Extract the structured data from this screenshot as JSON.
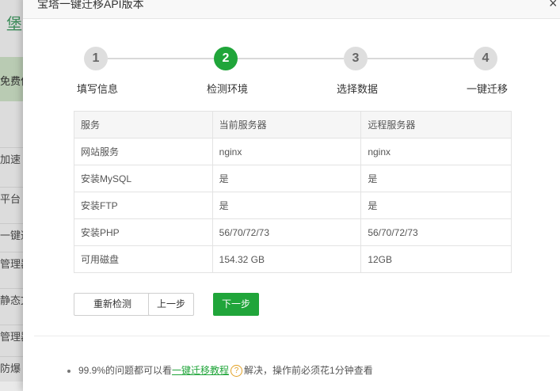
{
  "background": {
    "brand": "堡",
    "free_label": "免费使",
    "menu_items": [
      "加速",
      "平台",
      "一键迁",
      "管理器",
      "静态文",
      "管理器",
      "防爆"
    ]
  },
  "dialog": {
    "title": "宝塔一键迁移API版本",
    "close_symbol": "×",
    "steps": [
      {
        "number": "1",
        "label": "填写信息",
        "active": false
      },
      {
        "number": "2",
        "label": "检测环境",
        "active": true
      },
      {
        "number": "3",
        "label": "选择数据",
        "active": false
      },
      {
        "number": "4",
        "label": "一键迁移",
        "active": false
      }
    ],
    "table": {
      "headers": [
        "服务",
        "当前服务器",
        "远程服务器"
      ],
      "rows": [
        [
          "网站服务",
          "nginx",
          "nginx"
        ],
        [
          "安装MySQL",
          "是",
          "是"
        ],
        [
          "安装FTP",
          "是",
          "是"
        ],
        [
          "安装PHP",
          "56/70/72/73",
          "56/70/72/73"
        ],
        [
          "可用磁盘",
          "154.32 GB",
          "12GB"
        ]
      ]
    },
    "buttons": {
      "recheck": "重新检测",
      "prev": "上一步",
      "next": "下一步"
    },
    "tip": {
      "prefix": "99.9%的问题都可以看",
      "link": "一键迁移教程",
      "icon": "?",
      "suffix": "解决，操作前必须花1分钟查看"
    },
    "colors": {
      "accent": "#20a53a",
      "warning": "#e2a124"
    }
  }
}
